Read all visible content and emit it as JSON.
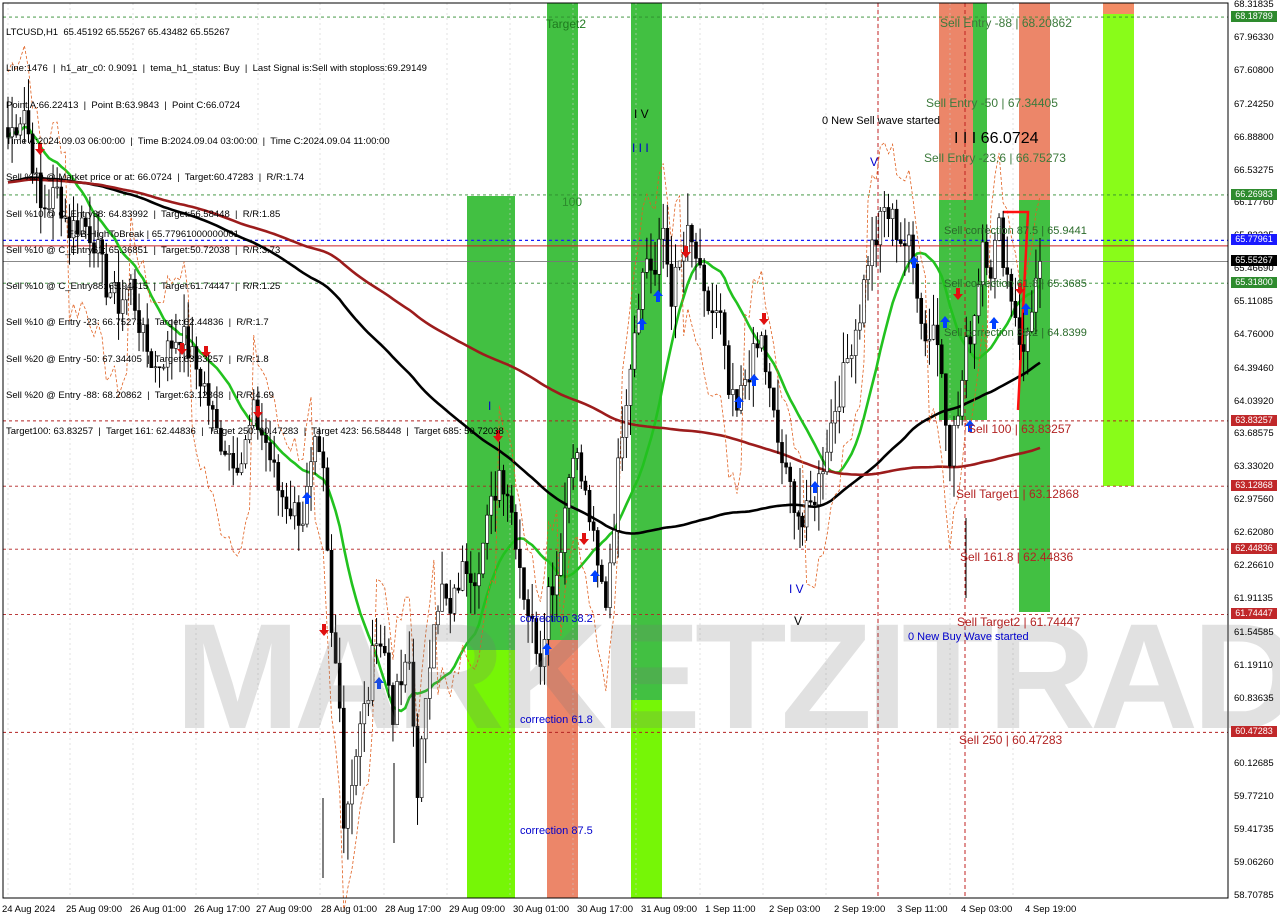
{
  "header": {
    "lines": [
      "LTCUSD,H1  65.45192 65.55267 65.43482 65.55267",
      "Line:1476  |  h1_atr_c0: 0.9091  |  tema_h1_status: Buy  |  Last Signal is:Sell with stoploss:69.29149",
      "Point A:66.22413  |  Point B:63.9843  |  Point C:66.0724",
      "Time A:2024.09.03 06:00:00  |  Time B:2024.09.04 03:00:00  |  Time C:2024.09.04 11:00:00",
      "Sell %20 @ Market price or at: 66.0724  |  Target:60.47283  |  R/R:1.74",
      "Sell %10 @ C_Entry38: 64.83992  |  Target:56.58448  |  R/R:1.85",
      "Sell %10 @ C_Entry61: 65.36851  |  Target:50.72038  |  R/R:3.73",
      "Sell %10 @ C_Entry88: 65.94415  |  Target:61.74447  |  R/R:1.25",
      "Sell %10 @ Entry -23: 66.75273  |  Target:62.44836  |  R/R:1.7",
      "Sell %20 @ Entry -50: 67.34405  |  Target:63.83257  |  R/R:1.8",
      "Sell %20 @ Entry -88: 68.20862  |  Target:63.12868  |  R/R:4.69",
      "Target100: 63.83257  |  Target 161: 62.44836  |  Target 250: 60.47283  |  Target 423: 56.58448  |  Target 685: 50.72038"
    ]
  },
  "watermark": "MARKETZITRADE",
  "colors": {
    "green_zone": "#2db92d",
    "lime_zone": "#7cfc00",
    "red_zone": "#ff7f6e",
    "ma_green": "#22c21f",
    "ma_black": "#000000",
    "ma_darkred": "#9c1c1c",
    "level_green": "#2e8b2e",
    "level_red": "#b22222",
    "fsb_blue": "#1a1aff",
    "arrow_up": "#0040ff",
    "arrow_down": "#e01010"
  },
  "chart_data": {
    "type": "candlestick",
    "symbol": "LTCUSD",
    "timeframe": "H1",
    "ylim": [
      58.70785,
      68.31835
    ],
    "y_ticks": [
      "68.31835",
      "67.96330",
      "67.60800",
      "67.24250",
      "66.88800",
      "66.53275",
      "66.17760",
      "65.82225",
      "65.46690",
      "65.11085",
      "64.76000",
      "64.39460",
      "64.03920",
      "63.68575",
      "63.33020",
      "62.97560",
      "62.62080",
      "62.26610",
      "61.91135",
      "61.54585",
      "61.19110",
      "60.83635",
      "60.48160",
      "60.12685",
      "59.77210",
      "59.41735",
      "59.06260",
      "58.70785"
    ],
    "x_labels": [
      "24 Aug 2024",
      "25 Aug 09:00",
      "26 Aug 01:00",
      "26 Aug 17:00",
      "27 Aug 09:00",
      "28 Aug 01:00",
      "28 Aug 17:00",
      "29 Aug 09:00",
      "30 Aug 01:00",
      "30 Aug 17:00",
      "31 Aug 09:00",
      "1 Sep 11:00",
      "2 Sep 03:00",
      "2 Sep 19:00",
      "3 Sep 11:00",
      "4 Sep 03:00",
      "4 Sep 19:00"
    ],
    "close_path": [
      [
        0,
        66.9
      ],
      [
        4,
        67.2
      ],
      [
        8,
        66.1
      ],
      [
        12,
        66.3
      ],
      [
        15,
        65.9
      ],
      [
        18,
        66.0
      ],
      [
        21,
        65.8
      ],
      [
        24,
        65.3
      ],
      [
        27,
        65.1
      ],
      [
        30,
        65.3
      ],
      [
        33,
        64.7
      ],
      [
        36,
        64.4
      ],
      [
        39,
        64.6
      ],
      [
        42,
        64.8
      ],
      [
        45,
        64.5
      ],
      [
        48,
        64.2
      ],
      [
        51,
        63.7
      ],
      [
        54,
        63.5
      ],
      [
        57,
        63.4
      ],
      [
        60,
        63.9
      ],
      [
        63,
        63.6
      ],
      [
        66,
        63.1
      ],
      [
        69,
        62.9
      ],
      [
        72,
        62.8
      ],
      [
        75,
        63.5
      ],
      [
        77,
        63.2
      ],
      [
        79,
        61.5
      ],
      [
        81,
        60.9
      ],
      [
        82,
        59.5
      ],
      [
        84,
        60.0
      ],
      [
        86,
        60.5
      ],
      [
        88,
        60.9
      ],
      [
        90,
        61.6
      ],
      [
        92,
        61.3
      ],
      [
        94,
        60.7
      ],
      [
        96,
        61.0
      ],
      [
        98,
        61.2
      ],
      [
        100,
        59.9
      ],
      [
        102,
        60.7
      ],
      [
        104,
        61.8
      ],
      [
        106,
        62.0
      ],
      [
        108,
        61.7
      ],
      [
        110,
        62.1
      ],
      [
        112,
        62.3
      ],
      [
        114,
        62.2
      ],
      [
        116,
        62.5
      ],
      [
        118,
        62.9
      ],
      [
        120,
        63.3
      ],
      [
        122,
        63.1
      ],
      [
        124,
        62.6
      ],
      [
        126,
        62.0
      ],
      [
        128,
        61.6
      ],
      [
        130,
        61.3
      ],
      [
        132,
        62.0
      ],
      [
        134,
        62.2
      ],
      [
        136,
        62.9
      ],
      [
        138,
        63.6
      ],
      [
        140,
        63.2
      ],
      [
        142,
        62.8
      ],
      [
        144,
        62.2
      ],
      [
        146,
        61.9
      ],
      [
        148,
        62.8
      ],
      [
        150,
        63.8
      ],
      [
        152,
        64.5
      ],
      [
        154,
        65.2
      ],
      [
        156,
        65.6
      ],
      [
        158,
        65.4
      ],
      [
        160,
        65.9
      ],
      [
        162,
        65.2
      ],
      [
        164,
        65.5
      ],
      [
        166,
        65.8
      ],
      [
        168,
        65.6
      ],
      [
        170,
        65.1
      ],
      [
        172,
        65.0
      ],
      [
        174,
        64.9
      ],
      [
        176,
        64.1
      ],
      [
        178,
        63.9
      ],
      [
        180,
        64.3
      ],
      [
        182,
        64.5
      ],
      [
        184,
        64.7
      ],
      [
        186,
        64.1
      ],
      [
        188,
        63.6
      ],
      [
        190,
        63.2
      ],
      [
        192,
        63.0
      ],
      [
        194,
        62.7
      ],
      [
        196,
        62.9
      ],
      [
        198,
        63.2
      ],
      [
        200,
        63.6
      ],
      [
        202,
        64.0
      ],
      [
        204,
        64.3
      ],
      [
        206,
        64.7
      ],
      [
        208,
        65.0
      ],
      [
        210,
        65.6
      ],
      [
        212,
        65.8
      ],
      [
        214,
        66.1
      ],
      [
        216,
        66.0
      ],
      [
        218,
        65.8
      ],
      [
        220,
        65.7
      ],
      [
        222,
        65.3
      ],
      [
        224,
        64.7
      ],
      [
        226,
        64.9
      ],
      [
        228,
        64.4
      ],
      [
        230,
        63.5
      ],
      [
        232,
        63.9
      ],
      [
        234,
        64.6
      ],
      [
        236,
        65.0
      ],
      [
        238,
        65.8
      ],
      [
        240,
        65.5
      ],
      [
        242,
        65.9
      ],
      [
        244,
        65.4
      ],
      [
        246,
        65.0
      ],
      [
        248,
        64.5
      ],
      [
        250,
        65.1
      ],
      [
        252,
        65.55267
      ]
    ],
    "series": [
      {
        "name": "FSB-HighToBreak",
        "value": 65.7796
      }
    ],
    "levels": [
      {
        "label": "68.18789",
        "value": 68.18789,
        "color": "green"
      },
      {
        "label": "66.26983",
        "value": 66.26983,
        "color": "green"
      },
      {
        "label": "65.77961",
        "value": 65.77961,
        "color": "blue"
      },
      {
        "label": "65.55267",
        "value": 65.55267,
        "color": "black"
      },
      {
        "label": "65.31800",
        "value": 65.318,
        "color": "green"
      },
      {
        "label": "63.83257",
        "value": 63.83257,
        "color": "red"
      },
      {
        "label": "63.12868",
        "value": 63.12868,
        "color": "red"
      },
      {
        "label": "62.44836",
        "value": 62.44836,
        "color": "red"
      },
      {
        "label": "61.74447",
        "value": 61.74447,
        "color": "red"
      },
      {
        "label": "60.47283",
        "value": 60.47283,
        "color": "red"
      }
    ],
    "annotations": {
      "fsb": "FSB-HighToBreak  |  65.77961000000001",
      "target2": "Target2",
      "sell_entry_88": "Sell Entry -88 | 68.20862",
      "sell_entry_50": "Sell Entry -50 | 67.34405",
      "wave_c": "I I I 66.0724",
      "sell_entry_23": "Sell Entry -23.6 | 66.75273",
      "new_sell_wave": "0 New Sell wave started",
      "sell_corr_88": "Sell correction 87.5 | 65.9441",
      "sell_corr_61": "Sell correction 61.8 | 65.3685",
      "sell_corr_38": "Sell correction 38.2 | 64.8399",
      "sell_100": "Sell 100 | 63.83257",
      "sell_target1": "Sell Target1 | 63.12868",
      "sell_161": "Sell 161.8 | 62.44836",
      "sell_target2": "Sell Target2 | 61.74447",
      "new_buy_wave": "0 New Buy Wave started",
      "sell_250": "Sell 250 | 60.47283",
      "corr_38": "correction 38.2",
      "corr_61": "correction 61.8",
      "corr_87": "correction 87.5",
      "hundred": "100",
      "wave_i": "I",
      "wave_iii": "I I I",
      "wave_iv_top": "I V",
      "wave_v_top": "V",
      "wave_iv_bot": "I V",
      "wave_v_bot": "V"
    }
  }
}
